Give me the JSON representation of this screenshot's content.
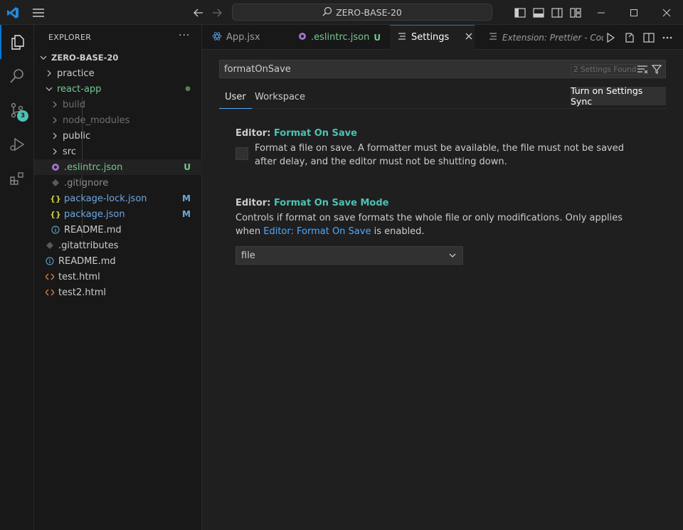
{
  "titlebar": {
    "search_text": "ZERO-BASE-20"
  },
  "activity": {
    "scm_badge": "3"
  },
  "explorer": {
    "title": "EXPLORER",
    "more": "···",
    "root": "ZERO-BASE-20",
    "items": [
      {
        "label": "practice"
      },
      {
        "label": "react-app"
      },
      {
        "label": "build"
      },
      {
        "label": "node_modules"
      },
      {
        "label": "public"
      },
      {
        "label": "src"
      },
      {
        "label": ".eslintrc.json",
        "status": "U"
      },
      {
        "label": ".gitignore"
      },
      {
        "label": "package-lock.json",
        "status": "M"
      },
      {
        "label": "package.json",
        "status": "M"
      },
      {
        "label": "README.md"
      },
      {
        "label": ".gitattributes"
      },
      {
        "label": "README.md"
      },
      {
        "label": "test.html"
      },
      {
        "label": "test2.html"
      }
    ],
    "colors": {
      "untracked": "#73c991",
      "modified": "#e2c08d",
      "ignored": "#8c8c8c",
      "default": "#cccccc",
      "modified_file": "#6ea8e0"
    }
  },
  "tabs": [
    {
      "label": "App.jsx"
    },
    {
      "label": ".eslintrc.json",
      "mark": "U"
    },
    {
      "label": "Settings"
    },
    {
      "label": "Extension: Prettier - Code"
    }
  ],
  "settings": {
    "search_value": "formatOnSave",
    "found": "2 Settings Found",
    "scope_user": "User",
    "scope_workspace": "Workspace",
    "sync_button": "Turn on Settings Sync",
    "s1": {
      "category": "Editor: ",
      "name": "Format On Save",
      "desc": "Format a file on save. A formatter must be available, the file must not be saved after delay, and the editor must not be shutting down."
    },
    "s2": {
      "category": "Editor: ",
      "name": "Format On Save Mode",
      "desc_pre": "Controls if format on save formats the whole file or only modifications. Only applies when ",
      "desc_link": "Editor: Format On Save",
      "desc_post": " is enabled.",
      "value": "file"
    }
  }
}
